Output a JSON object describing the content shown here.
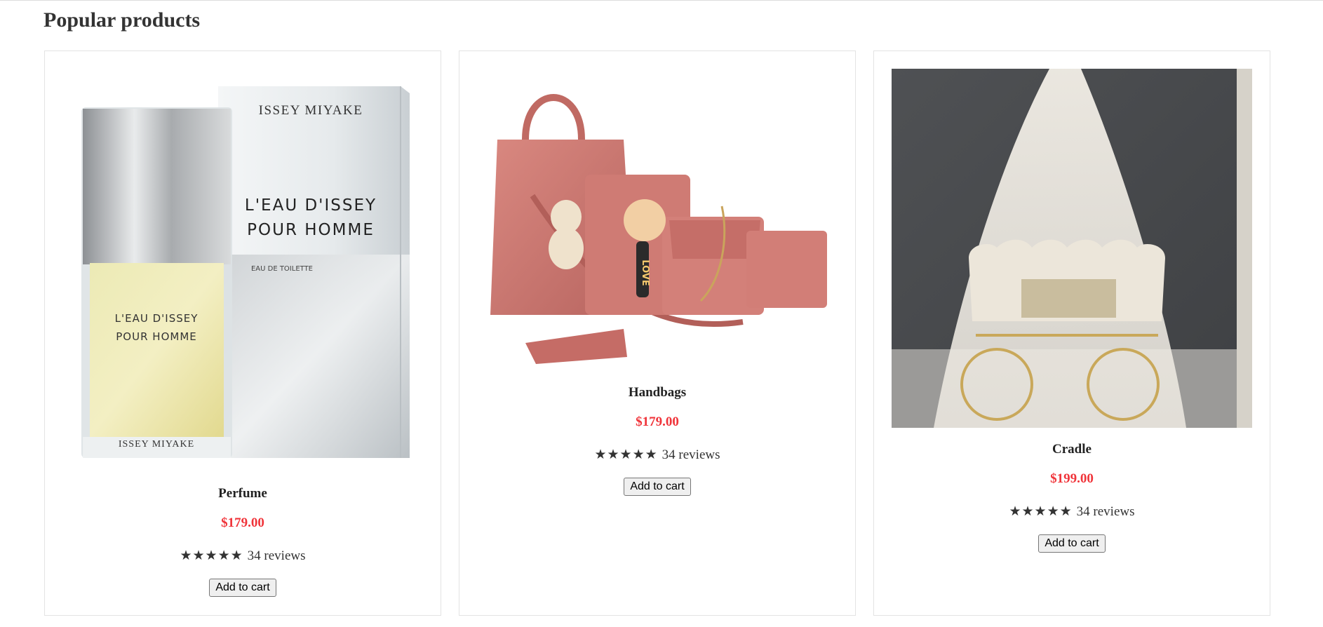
{
  "section": {
    "title": "Popular products"
  },
  "products": [
    {
      "name": "Perfume",
      "price": "$179.00",
      "stars": "★★★★★",
      "reviews": "34 reviews",
      "button": "Add to cart",
      "image": {
        "brand": "ISSEY MIYAKE",
        "product_line1": "L'EAU D'ISSEY",
        "product_line2": "POUR HOMME",
        "type": "EAU DE TOILETTE"
      }
    },
    {
      "name": "Handbags",
      "price": "$179.00",
      "stars": "★★★★★",
      "reviews": "34 reviews",
      "button": "Add to cart",
      "image": {
        "tag_text": "LOVE"
      }
    },
    {
      "name": "Cradle",
      "price": "$199.00",
      "stars": "★★★★★",
      "reviews": "34 reviews",
      "button": "Add to cart"
    }
  ],
  "colors": {
    "price": "#f0343a",
    "handbag": "#c9736e",
    "card_border": "#e3e3e3"
  }
}
